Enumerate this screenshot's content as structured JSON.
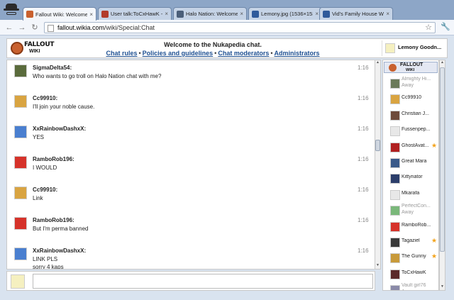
{
  "browser": {
    "tabs": [
      {
        "label": "Fallout Wiki: Welcome",
        "active": true,
        "favicon_color": "#c9612f"
      },
      {
        "label": "User talk:ToCxHawK - ",
        "active": false,
        "favicon_color": "#b23b2b"
      },
      {
        "label": "Halo Nation: Welcome",
        "active": false,
        "favicon_color": "#4b5f7a"
      },
      {
        "label": "Lemony.jpg (1536×153",
        "active": false,
        "favicon_color": "#2f5a9b"
      },
      {
        "label": "Vid's Family House Wi",
        "active": false,
        "favicon_color": "#2f5a9b"
      }
    ],
    "url_host": "fallout.wikia.com",
    "url_path": "/wiki/Special:Chat"
  },
  "header": {
    "logo_line1": "FALLOUT",
    "logo_line2": "WIKI",
    "welcome": "Welcome to the Nukapedia chat.",
    "links": [
      "Chat rules",
      "Policies and guidelines",
      "Chat moderators",
      "Administrators"
    ],
    "current_user": "Lemony Goodn..."
  },
  "messages": [
    {
      "user": "SigmaDelta54:",
      "text": "Who wants to go troll on Halo Nation chat with me?",
      "time": "1:16",
      "avatar_color": "#5a6b3c"
    },
    {
      "user": "Cc99910:",
      "text": "I'll join your noble cause.",
      "time": "1:16",
      "avatar_color": "#d9a441"
    },
    {
      "user": "XxRainbowDashxX:",
      "text": "YES",
      "time": "1:16",
      "avatar_color": "#4a7fd0"
    },
    {
      "user": "RamboRob196:",
      "text": "I WOULD",
      "time": "1:16",
      "avatar_color": "#d6322a"
    },
    {
      "user": "Cc99910:",
      "text": "Link",
      "time": "1:16",
      "avatar_color": "#d9a441"
    },
    {
      "user": "RamboRob196:",
      "text": "But I'm perma banned",
      "time": "1:16",
      "avatar_color": "#d6322a"
    },
    {
      "user": "XxRainbowDashxX:",
      "text": "LINK PLS",
      "text2": "sorry 4 kaps",
      "time": "1:16",
      "avatar_color": "#4a7fd0"
    }
  ],
  "userlist": {
    "logo_line1": "FALLOUT",
    "logo_line2": "WIKI",
    "away_label": "Away",
    "users": [
      {
        "name": "Almighty Hi...",
        "away": true,
        "star": false,
        "avatar_color": "#6b7a5a"
      },
      {
        "name": "Cc99910",
        "away": false,
        "star": false,
        "avatar_color": "#d9a441"
      },
      {
        "name": "Christian J...",
        "away": false,
        "star": false,
        "avatar_color": "#6d4a3a"
      },
      {
        "name": "Fussenpep...",
        "away": false,
        "star": false,
        "avatar_color": "#e8e8e8"
      },
      {
        "name": "GhostAvat...",
        "away": false,
        "star": true,
        "avatar_color": "#b02020"
      },
      {
        "name": "Great Mara",
        "away": false,
        "star": false,
        "avatar_color": "#3a5a8a"
      },
      {
        "name": "Kittynator",
        "away": false,
        "star": false,
        "avatar_color": "#2c3e6b"
      },
      {
        "name": "Mkarafa",
        "away": false,
        "star": false,
        "avatar_color": "#e8e8e8"
      },
      {
        "name": "PerfectCon...",
        "away": true,
        "star": false,
        "avatar_color": "#7ab87a"
      },
      {
        "name": "RamboRob...",
        "away": false,
        "star": false,
        "avatar_color": "#d6322a"
      },
      {
        "name": "Tagaziel",
        "away": false,
        "star": true,
        "avatar_color": "#3a3a3a"
      },
      {
        "name": "The Gunny",
        "away": false,
        "star": true,
        "avatar_color": "#c89a3a"
      },
      {
        "name": "ToCxHawK",
        "away": false,
        "star": false,
        "avatar_color": "#5a2a2a"
      },
      {
        "name": "Vault girl76",
        "away": true,
        "star": false,
        "avatar_color": "#8a8aa8"
      }
    ]
  },
  "input": {
    "placeholder": ""
  },
  "colors": {
    "link": "#1d4f91",
    "star": "#f3a31b",
    "chrome": "#8da6c7"
  }
}
